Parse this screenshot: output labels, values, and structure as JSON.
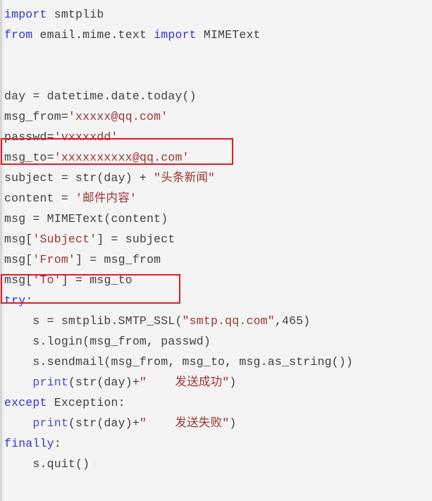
{
  "editor": {
    "language": "python",
    "background_color": "#f4f4f4",
    "text_color": "#404040",
    "keyword_color": "#3333cc",
    "string_color": "#993333",
    "annotation_color": "#e61a23"
  },
  "annotations": [
    {
      "name": "msg-to-assignment-highlight",
      "label": "msg_to='xxxxxxxxxx@qq.com'"
    },
    {
      "name": "msg-to-header-highlight",
      "label": "msg['To'] = msg_to"
    }
  ],
  "code_lines": [
    {
      "n": 1,
      "segments": [
        {
          "t": "import",
          "c": "kw"
        },
        {
          "t": " smtplib",
          "c": "plain"
        }
      ]
    },
    {
      "n": 2,
      "segments": [
        {
          "t": "from",
          "c": "kw"
        },
        {
          "t": " email.mime.text ",
          "c": "plain"
        },
        {
          "t": "import",
          "c": "kw"
        },
        {
          "t": " MIMEText",
          "c": "plain"
        }
      ]
    },
    {
      "n": 3,
      "segments": []
    },
    {
      "n": 4,
      "segments": []
    },
    {
      "n": 5,
      "segments": [
        {
          "t": "day = datetime.date.today()",
          "c": "plain"
        }
      ]
    },
    {
      "n": 6,
      "segments": [
        {
          "t": "msg_from=",
          "c": "plain"
        },
        {
          "t": "'xxxxx@qq.com'",
          "c": "str"
        }
      ]
    },
    {
      "n": 7,
      "segments": [
        {
          "t": "passwd=",
          "c": "plain"
        },
        {
          "t": "'vxxxxdd'",
          "c": "str"
        }
      ]
    },
    {
      "n": 8,
      "segments": [
        {
          "t": "msg_to=",
          "c": "plain"
        },
        {
          "t": "'xxxxxxxxxx@qq.com'",
          "c": "str"
        }
      ]
    },
    {
      "n": 9,
      "segments": [
        {
          "t": "subject = str(day) + ",
          "c": "plain"
        },
        {
          "t": "\"头条新闻\"",
          "c": "str"
        }
      ]
    },
    {
      "n": 10,
      "segments": [
        {
          "t": "content = ",
          "c": "plain"
        },
        {
          "t": "'邮件内容'",
          "c": "str"
        }
      ]
    },
    {
      "n": 11,
      "segments": [
        {
          "t": "msg = MIMEText(content)",
          "c": "plain"
        }
      ]
    },
    {
      "n": 12,
      "segments": [
        {
          "t": "msg[",
          "c": "plain"
        },
        {
          "t": "'Subject'",
          "c": "str"
        },
        {
          "t": "] = subject",
          "c": "plain"
        }
      ]
    },
    {
      "n": 13,
      "segments": [
        {
          "t": "msg[",
          "c": "plain"
        },
        {
          "t": "'From'",
          "c": "str"
        },
        {
          "t": "] = msg_from",
          "c": "plain"
        }
      ]
    },
    {
      "n": 14,
      "segments": [
        {
          "t": "msg[",
          "c": "plain"
        },
        {
          "t": "'To'",
          "c": "str"
        },
        {
          "t": "] = msg_to",
          "c": "plain"
        }
      ]
    },
    {
      "n": 15,
      "segments": [
        {
          "t": "try",
          "c": "kw"
        },
        {
          "t": ":",
          "c": "plain"
        }
      ]
    },
    {
      "n": 16,
      "segments": [
        {
          "t": "    s = smtplib.SMTP_SSL(",
          "c": "plain"
        },
        {
          "t": "\"smtp.qq.com\"",
          "c": "str"
        },
        {
          "t": ",465)",
          "c": "plain"
        }
      ]
    },
    {
      "n": 17,
      "segments": [
        {
          "t": "    s.login(msg_from, passwd)",
          "c": "plain"
        }
      ]
    },
    {
      "n": 18,
      "segments": [
        {
          "t": "    s.sendmail(msg_from, msg_to, msg.as_string())",
          "c": "plain"
        }
      ]
    },
    {
      "n": 19,
      "segments": [
        {
          "t": "    ",
          "c": "plain"
        },
        {
          "t": "print",
          "c": "builtin"
        },
        {
          "t": "(str(day)+",
          "c": "plain"
        },
        {
          "t": "\"    发送成功\"",
          "c": "str"
        },
        {
          "t": ")",
          "c": "plain"
        }
      ]
    },
    {
      "n": 20,
      "segments": [
        {
          "t": "except",
          "c": "kw"
        },
        {
          "t": " Exception:",
          "c": "plain"
        }
      ]
    },
    {
      "n": 21,
      "segments": [
        {
          "t": "    ",
          "c": "plain"
        },
        {
          "t": "print",
          "c": "builtin"
        },
        {
          "t": "(str(day)+",
          "c": "plain"
        },
        {
          "t": "\"    发送失败\"",
          "c": "str"
        },
        {
          "t": ")",
          "c": "plain"
        }
      ]
    },
    {
      "n": 22,
      "segments": [
        {
          "t": "finally",
          "c": "kw"
        },
        {
          "t": ":",
          "c": "plain"
        }
      ]
    },
    {
      "n": 23,
      "segments": [
        {
          "t": "    s.quit()",
          "c": "plain"
        }
      ]
    }
  ]
}
